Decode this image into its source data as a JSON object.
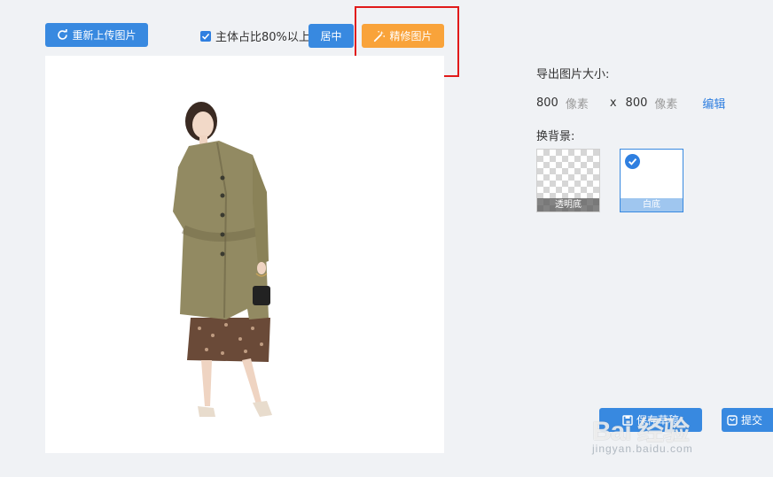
{
  "toolbar": {
    "reupload_label": "重新上传图片",
    "ratio_label": "主体占比80%以上",
    "ratio_checked": true,
    "center_label": "居中",
    "refine_label": "精修图片"
  },
  "export": {
    "label": "导出图片大小:",
    "width": "800",
    "width_unit": "像素",
    "times": "x",
    "height": "800",
    "height_unit": "像素",
    "edit_label": "编辑"
  },
  "background": {
    "label": "换背景:",
    "options": [
      {
        "caption": "透明底",
        "selected": false
      },
      {
        "caption": "白底",
        "selected": true
      }
    ]
  },
  "actions": {
    "save_draft_label": "保存草稿",
    "submit_label": "提交"
  },
  "watermark": {
    "main": "Bai 经验",
    "sub": "jingyan.baidu.com"
  },
  "colors": {
    "primary": "#3889e0",
    "accent": "#f9a33a",
    "highlight": "#e11a1a",
    "page_bg": "#f0f2f5"
  },
  "icons": {
    "reupload": "refresh-icon",
    "refine": "magic-wand-icon",
    "save": "save-icon",
    "submit": "submit-icon",
    "selected": "check-icon"
  }
}
